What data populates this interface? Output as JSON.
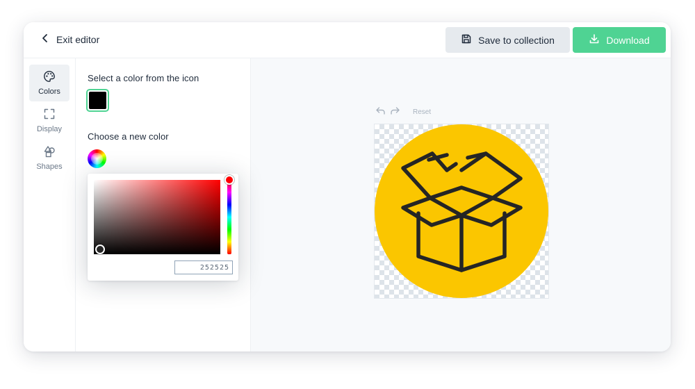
{
  "header": {
    "exit_label": "Exit editor",
    "save_label": "Save to collection",
    "download_label": "Download"
  },
  "rail": {
    "items": [
      {
        "label": "Colors",
        "icon": "palette-icon",
        "active": true
      },
      {
        "label": "Display",
        "icon": "expand-icon",
        "active": false
      },
      {
        "label": "Shapes",
        "icon": "shapes-icon",
        "active": false
      }
    ]
  },
  "panel": {
    "select_title": "Select a color from the icon",
    "choose_title": "Choose a new color",
    "selected_color": "#000000"
  },
  "picker": {
    "hex_value": "252525",
    "hue_color": "#ff0000",
    "current_color": "#252525"
  },
  "canvas": {
    "reset_label": "Reset",
    "icon_subject": "open-box-icon",
    "circle_color": "#fbc600",
    "stroke_color": "#252525"
  },
  "colors": {
    "accent": "#4fd393",
    "save_bg": "#e6eaee"
  }
}
